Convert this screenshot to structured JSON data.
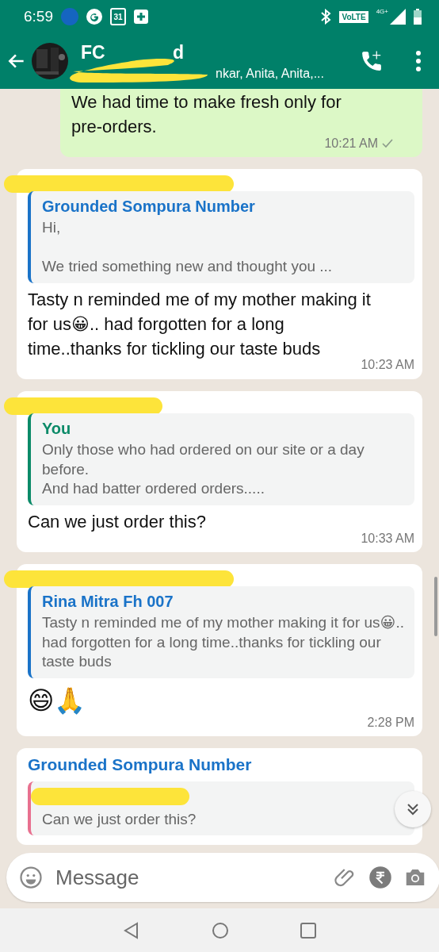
{
  "status_bar": {
    "time": "6:59",
    "calendar_day": "31",
    "volte": "VoLTE",
    "network": "4G+"
  },
  "header": {
    "title_start": "FC",
    "title_end": "d",
    "subtitle_end": "nkar, Anita, Anita,...",
    "redacted": true
  },
  "messages": [
    {
      "kind": "outgoing",
      "body": "We had time to make fresh only for pre-orders.",
      "time": "10:21 AM",
      "sent": true
    },
    {
      "kind": "incoming",
      "sender_redacted": true,
      "quote": {
        "name": "Grounded Sompura Number",
        "color": "#1a73c8",
        "text": "Hi,\n\nWe tried something new and thought you ..."
      },
      "body": "Tasty n reminded me of my mother making it for us😀.. had forgotten for a long time..thanks for tickling our taste buds",
      "time": "10:23 AM"
    },
    {
      "kind": "incoming",
      "sender_redacted": true,
      "quote": {
        "name": "You",
        "color": "#0b8a68",
        "text": "Only those who had ordered on our site or a day before.\nAnd had batter ordered orders....."
      },
      "body": "Can we just order this?",
      "time": "10:33 AM"
    },
    {
      "kind": "incoming",
      "sender_redacted": true,
      "quote": {
        "name": "Rina Mitra Fh 007",
        "color": "#1a73c8",
        "text": "Tasty n reminded me of my mother making it for us😀.. had forgotten for a long time..thanks for tickling our taste buds"
      },
      "emoji": "😄🙏",
      "time": "2:28 PM"
    },
    {
      "kind": "incoming",
      "sender": "Grounded Sompura Number",
      "quote": {
        "name_redacted": true,
        "color": "#e8708f",
        "text": "Can we just order this?"
      }
    }
  ],
  "composer": {
    "placeholder": "Message"
  }
}
